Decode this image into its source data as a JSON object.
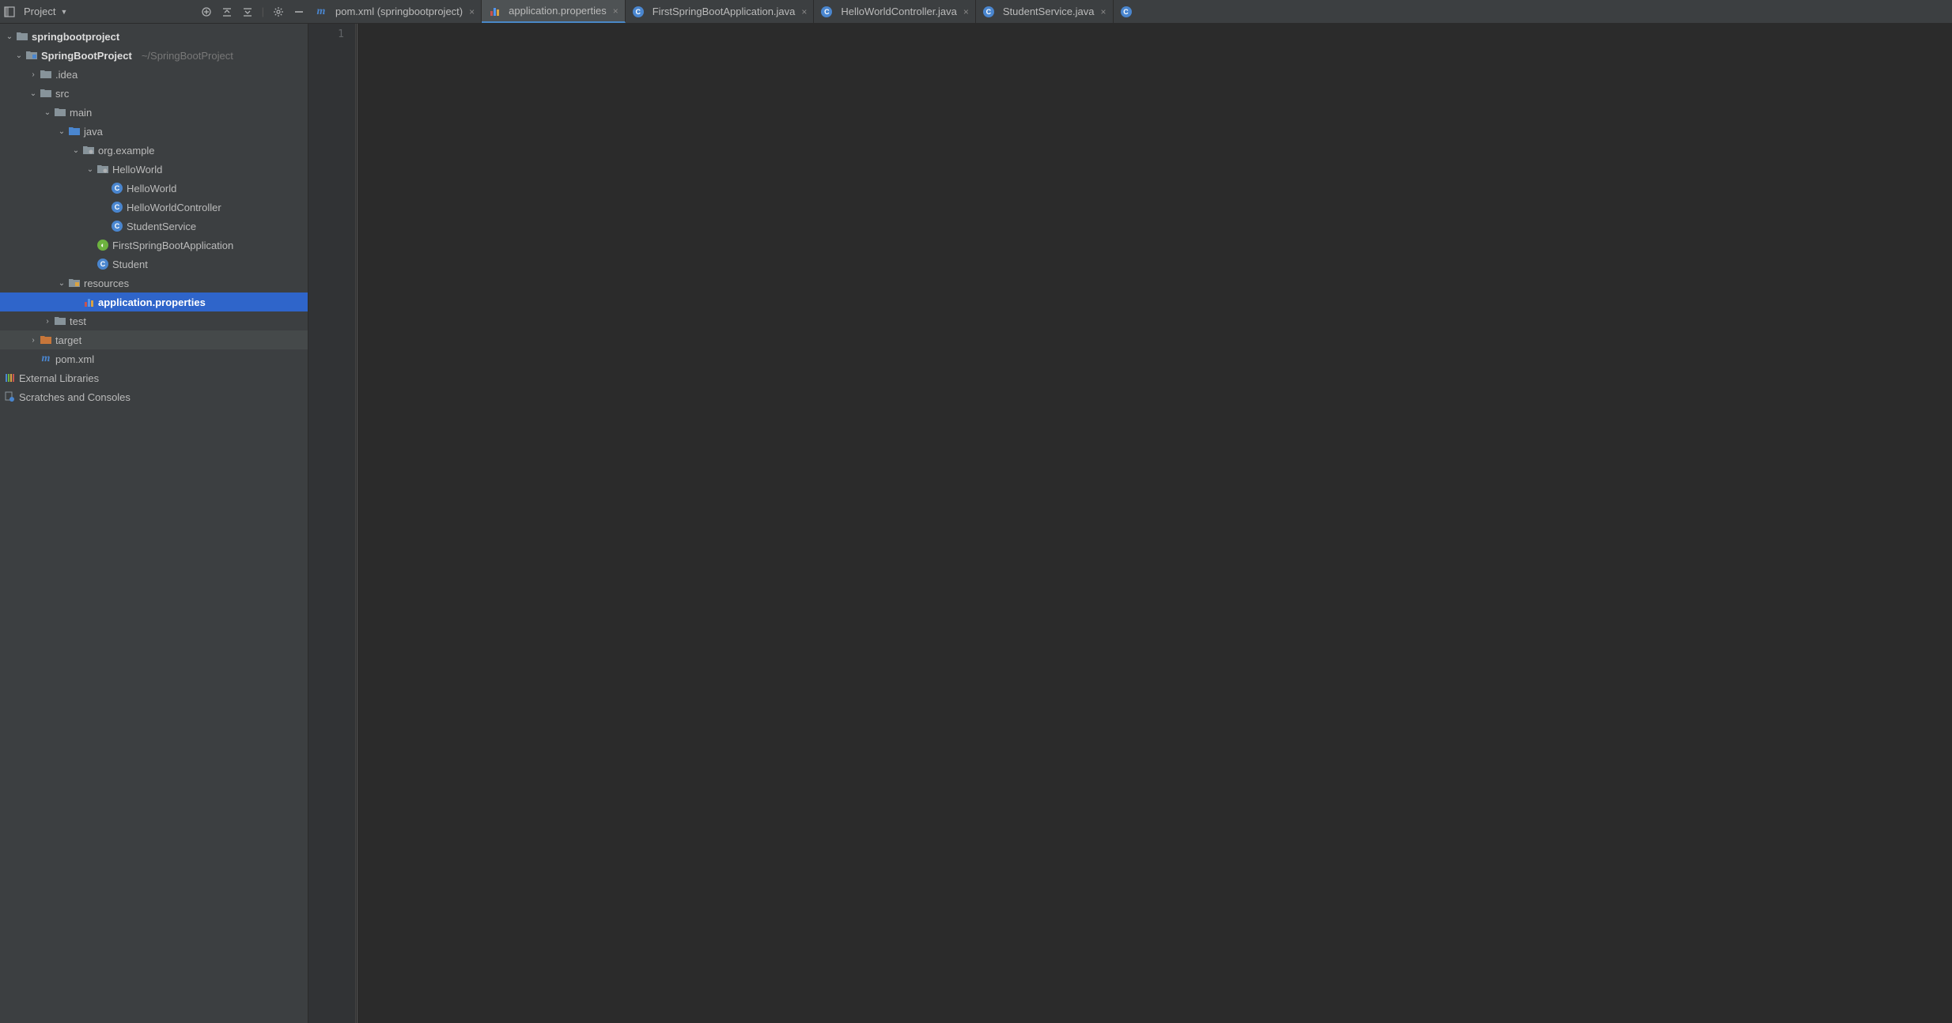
{
  "toolwindow": {
    "title": "Project"
  },
  "tabs": [
    {
      "label": "pom.xml (springbootproject)",
      "icon": "m",
      "active": false
    },
    {
      "label": "application.properties",
      "icon": "props",
      "active": true
    },
    {
      "label": "FirstSpringBootApplication.java",
      "icon": "class",
      "active": false
    },
    {
      "label": "HelloWorldController.java",
      "icon": "class",
      "active": false
    },
    {
      "label": "StudentService.java",
      "icon": "class",
      "active": false
    }
  ],
  "tree": {
    "root": "springbootproject",
    "module": "SpringBootProject",
    "module_path": "~/SpringBootProject",
    "idea": ".idea",
    "src": "src",
    "main": "main",
    "java": "java",
    "pkg": "org.example",
    "hw_pkg": "HelloWorld",
    "hw_class": "HelloWorld",
    "hw_ctrl": "HelloWorldController",
    "stu_svc": "StudentService",
    "spring_app": "FirstSpringBootApplication",
    "student": "Student",
    "resources": "resources",
    "app_props": "application.properties",
    "test": "test",
    "target": "target",
    "pom": "pom.xml",
    "ext_lib": "External Libraries",
    "scratches": "Scratches and Consoles"
  },
  "editor": {
    "line1": "1"
  }
}
